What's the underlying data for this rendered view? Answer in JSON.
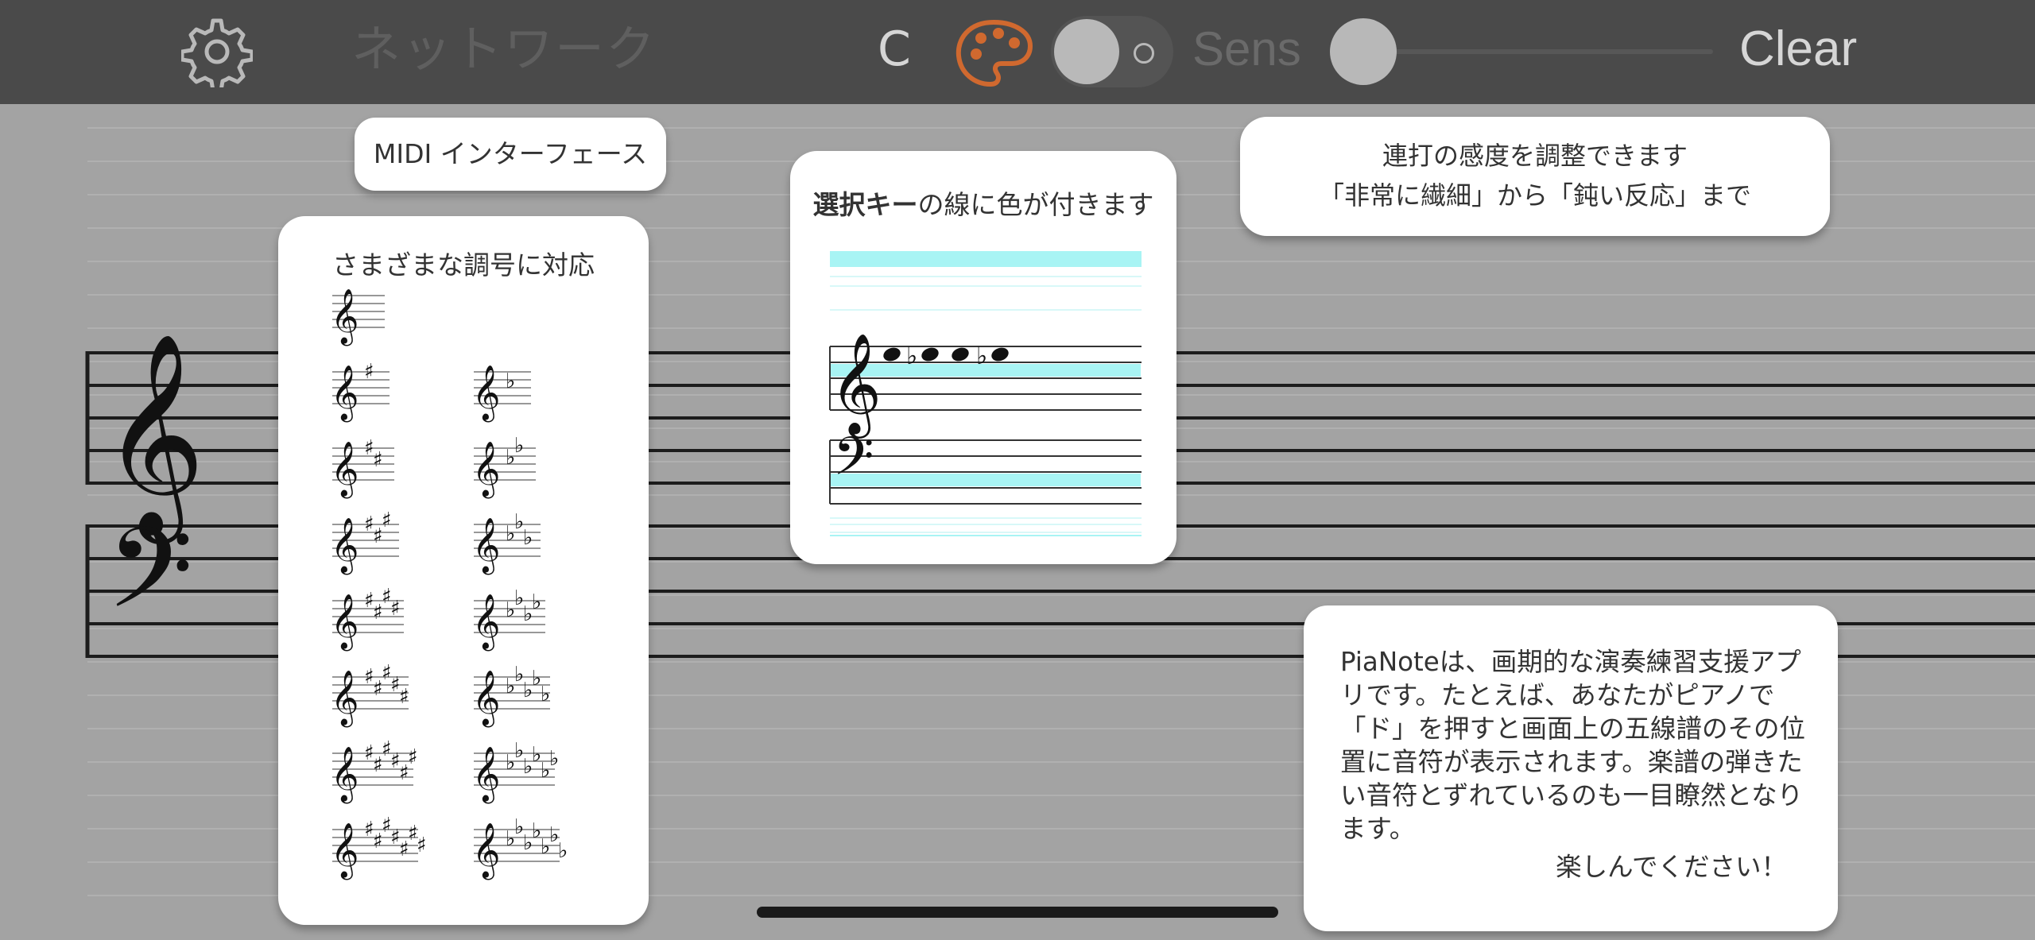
{
  "toolbar": {
    "network_label": "ネットワーク",
    "key_label": "C",
    "sens_label": "Sens",
    "clear_label": "Clear",
    "toggle_state": "off",
    "sens_slider_value": 0,
    "palette_color": "#d0692f"
  },
  "callouts": {
    "midi": "MIDI インターフェース",
    "sensitivity_line1": "連打の感度を調整できます",
    "sensitivity_line2": "「非常に繊細」から「鈍い反応」まで",
    "key_signatures": "さまざまな調号に対応",
    "color_bold": "選択キー",
    "color_rest": "の線に色が付きます",
    "info_body": "PiaNoteは、画期的な演奏練習支援アプリです。たとえば、あなたがピアノで「ド」を押すと画面上の五線譜のその位置に音符が表示されます。楽譜の弾きたい音符とずれているのも一目瞭然となります。",
    "info_end": "楽しんでください！"
  },
  "key_signature_list": {
    "sharps": [
      0,
      1,
      2,
      3,
      4,
      5,
      6,
      7
    ],
    "flats": [
      1,
      2,
      3,
      4,
      5,
      6,
      7
    ]
  },
  "colors": {
    "toolbar": "#4a4a4a",
    "background": "#a3a3a3",
    "highlight_line": "#a8f4f4",
    "bubble": "#ffffff"
  }
}
